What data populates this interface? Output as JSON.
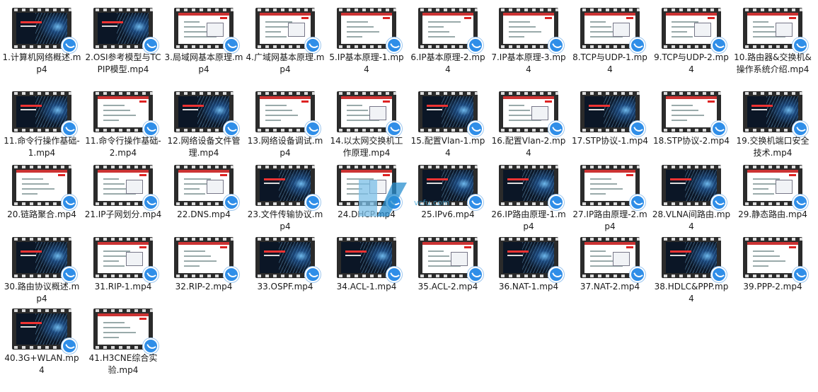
{
  "folder": {
    "files": [
      {
        "name": "1.计算机网络概述.mp4",
        "style": "dark"
      },
      {
        "name": "2.OSI参考模型与TCPIP模型.mp4",
        "style": "dark"
      },
      {
        "name": "3.局域网基本原理.mp4",
        "style": "white"
      },
      {
        "name": "4.广域网基本原理.mp4",
        "style": "white"
      },
      {
        "name": "5.IP基本原理-1.mp4",
        "style": "white"
      },
      {
        "name": "6.IP基本原理-2.mp4",
        "style": "white"
      },
      {
        "name": "7.IP基本原理-3.mp4",
        "style": "white"
      },
      {
        "name": "8.TCP与UDP-1.mp4",
        "style": "white"
      },
      {
        "name": "9.TCP与UDP-2.mp4",
        "style": "white"
      },
      {
        "name": "10.路由器&交换机&操作系统介绍.mp4",
        "style": "white"
      },
      {
        "name": "11.命令行操作基础-1.mp4",
        "style": "dark"
      },
      {
        "name": "11.命令行操作基础-2.mp4",
        "style": "white"
      },
      {
        "name": "12.网络设备文件管理.mp4",
        "style": "dark"
      },
      {
        "name": "13.网络设备调试.mp4",
        "style": "white"
      },
      {
        "name": "14.以太网交换机工作原理.mp4",
        "style": "white"
      },
      {
        "name": "15.配置Vlan-1.mp4",
        "style": "dark"
      },
      {
        "name": "16.配置Vlan-2.mp4",
        "style": "white"
      },
      {
        "name": "17.STP协议-1.mp4",
        "style": "dark"
      },
      {
        "name": "18.STP协议-2.mp4",
        "style": "white"
      },
      {
        "name": "19.交换机端口安全技术.mp4",
        "style": "dark"
      },
      {
        "name": "20.链路聚合.mp4",
        "style": "white"
      },
      {
        "name": "21.IP子网划分.mp4",
        "style": "white"
      },
      {
        "name": "22.DNS.mp4",
        "style": "white"
      },
      {
        "name": "23.文件传输协议.mp4",
        "style": "dark"
      },
      {
        "name": "24.DHCP.mp4",
        "style": "white"
      },
      {
        "name": "25.IPv6.mp4",
        "style": "dark"
      },
      {
        "name": "26.IP路由原理-1.mp4",
        "style": "dark"
      },
      {
        "name": "27.IP路由原理-2.mp4",
        "style": "white"
      },
      {
        "name": "28.VLNA间路由.mp4",
        "style": "dark"
      },
      {
        "name": "29.静态路由.mp4",
        "style": "white"
      },
      {
        "name": "30.路由协议概述.mp4",
        "style": "dark"
      },
      {
        "name": "31.RIP-1.mp4",
        "style": "white"
      },
      {
        "name": "32.RIP-2.mp4",
        "style": "white"
      },
      {
        "name": "33.OSPF.mp4",
        "style": "dark"
      },
      {
        "name": "34.ACL-1.mp4",
        "style": "dark"
      },
      {
        "name": "35.ACL-2.mp4",
        "style": "white"
      },
      {
        "name": "36.NAT-1.mp4",
        "style": "dark"
      },
      {
        "name": "37.NAT-2.mp4",
        "style": "white"
      },
      {
        "name": "38.HDLC&PPP.mp4",
        "style": "dark"
      },
      {
        "name": "39.PPP-2.mp4",
        "style": "white"
      },
      {
        "name": "40.3G+WLAN.mp4",
        "style": "dark"
      },
      {
        "name": "41.H3CNE综合实验.mp4",
        "style": "white"
      }
    ],
    "watermark": "vcfu.com"
  }
}
